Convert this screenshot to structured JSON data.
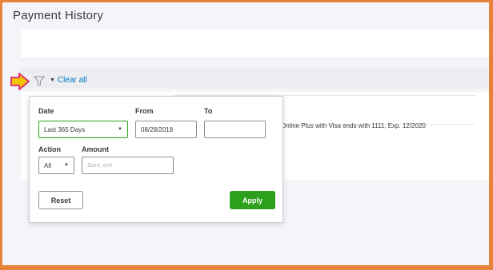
{
  "page": {
    "title": "Payment History"
  },
  "filter_bar": {
    "clear_all_label": "Clear all"
  },
  "filter_popover": {
    "date": {
      "label": "Date",
      "value": "Last 365 Days"
    },
    "from": {
      "label": "From",
      "value": "08/28/2018"
    },
    "to": {
      "label": "To",
      "value": ""
    },
    "action": {
      "label": "Action",
      "value": "All"
    },
    "amount": {
      "label": "Amount",
      "placeholder": "$amt, amt"
    },
    "reset_label": "Reset",
    "apply_label": "Apply"
  },
  "table": {
    "rows": [
      {
        "description": "Online Plus with Visa ends with 1111, Exp. 12/2020"
      }
    ]
  },
  "colors": {
    "border_accent": "#e8823a",
    "marker": "#f5c400",
    "marker_outline": "#e0337a",
    "link": "#0077c5",
    "apply": "#2ca01c"
  },
  "icons": [
    "arrow-pointer-icon",
    "filter-icon",
    "caret-down-icon"
  ]
}
